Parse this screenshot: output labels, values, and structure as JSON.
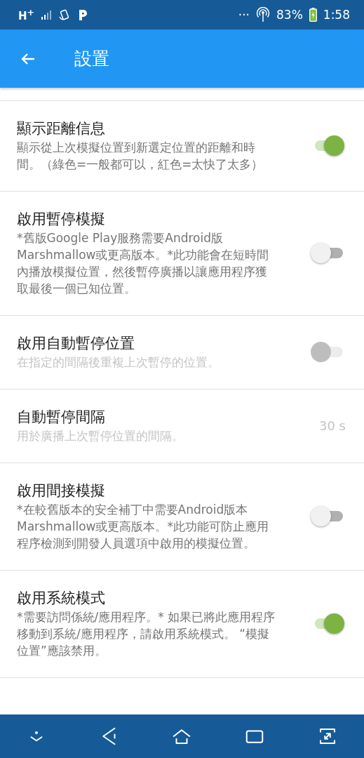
{
  "status_bar": {
    "network": "H$^{+}$",
    "more": "···",
    "battery_percent": "83%",
    "time": "1:58"
  },
  "app_bar": {
    "title": "設置"
  },
  "preferences": [
    {
      "kind": "switch",
      "title": "顯示距離信息",
      "summary": "顯示從上次模擬位置到新選定位置的距離和時間。（綠色=一般都可以，紅色=太快了太多）",
      "on": true,
      "disabled": false
    },
    {
      "kind": "switch",
      "title": "啟用暫停模擬",
      "summary": "*舊版Google Play服務需要Android版Marshmallow或更高版本。*此功能會在短時間內播放模擬位置，然後暫停廣播以讓應用程序獲取最後一個已知位置。",
      "on": false,
      "disabled": false
    },
    {
      "kind": "switch",
      "title": "啟用自動暫停位置",
      "summary": "在指定的間隔後重複上次暫停的位置。",
      "on": false,
      "disabled": true
    },
    {
      "kind": "value",
      "title": "自動暫停間隔",
      "summary": "用於廣播上次暫停位置的間隔。",
      "value": "30 s",
      "disabled": true
    },
    {
      "kind": "switch",
      "title": "啟用間接模擬",
      "summary": "*在較舊版本的安全補丁中需要Android版本Marshmallow或更高版本。*此功能可防止應用程序檢測到開發人員選項中啟用的模擬位置。",
      "on": false,
      "disabled": false
    },
    {
      "kind": "switch",
      "title": "啟用系統模式",
      "summary": "*需要訪問係統/應用程序。* 如果已將此應用程序移動到系統/應用程序，請啟用系統模式。 “模擬位置”應該禁用。",
      "on": true,
      "disabled": false
    }
  ]
}
